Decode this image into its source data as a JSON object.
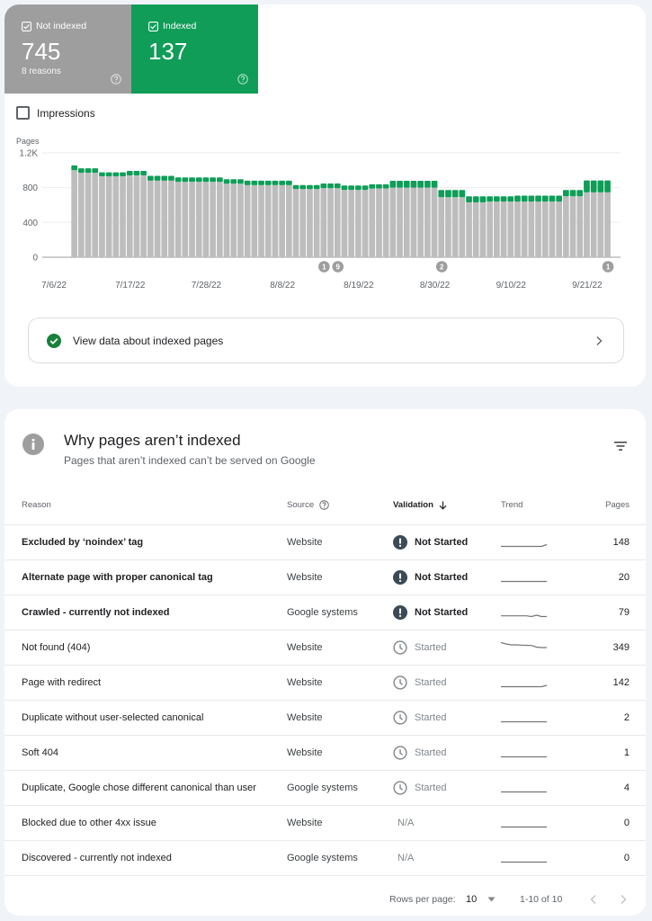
{
  "summary": {
    "not_indexed": {
      "label": "Not indexed",
      "value": "745",
      "sub": "8 reasons",
      "checked": true,
      "color": "#9e9e9e",
      "icon": "help-icon"
    },
    "indexed": {
      "label": "Indexed",
      "value": "137",
      "checked": true,
      "color": "#0f9d58",
      "icon": "help-icon"
    }
  },
  "impressions": {
    "label": "Impressions",
    "checked": false
  },
  "chart_data": {
    "type": "bar",
    "stacked": true,
    "ylabel": "Pages",
    "xlabel": "",
    "ylim": [
      0,
      1200
    ],
    "yticks": [
      0,
      400,
      800,
      1200
    ],
    "ytick_labels": [
      "0",
      "400",
      "800",
      "1.2K"
    ],
    "grid": true,
    "xticks": [
      "7/6/22",
      "7/17/22",
      "7/28/22",
      "8/8/22",
      "8/19/22",
      "8/30/22",
      "9/10/22",
      "9/21/22"
    ],
    "x": [
      "7/9/22",
      "7/10/22",
      "7/11/22",
      "7/12/22",
      "7/13/22",
      "7/14/22",
      "7/15/22",
      "7/16/22",
      "7/17/22",
      "7/18/22",
      "7/19/22",
      "7/20/22",
      "7/21/22",
      "7/22/22",
      "7/23/22",
      "7/24/22",
      "7/25/22",
      "7/26/22",
      "7/27/22",
      "7/28/22",
      "7/29/22",
      "7/30/22",
      "7/31/22",
      "8/1/22",
      "8/2/22",
      "8/3/22",
      "8/4/22",
      "8/5/22",
      "8/6/22",
      "8/7/22",
      "8/8/22",
      "8/9/22",
      "8/10/22",
      "8/11/22",
      "8/12/22",
      "8/13/22",
      "8/14/22",
      "8/15/22",
      "8/16/22",
      "8/17/22",
      "8/18/22",
      "8/19/22",
      "8/20/22",
      "8/21/22",
      "8/22/22",
      "8/23/22",
      "8/24/22",
      "8/25/22",
      "8/26/22",
      "8/27/22",
      "8/28/22",
      "8/29/22",
      "8/30/22",
      "8/31/22",
      "9/1/22",
      "9/2/22",
      "9/3/22",
      "9/4/22",
      "9/5/22",
      "9/6/22",
      "9/7/22",
      "9/8/22",
      "9/9/22",
      "9/10/22",
      "9/11/22",
      "9/12/22",
      "9/13/22",
      "9/14/22",
      "9/15/22",
      "9/16/22",
      "9/17/22",
      "9/18/22",
      "9/19/22",
      "9/20/22",
      "9/21/22",
      "9/22/22",
      "9/23/22",
      "9/24/22"
    ],
    "series": [
      {
        "name": "Not indexed",
        "color": "#bdbdbd",
        "values": [
          1000,
          970,
          970,
          970,
          930,
          930,
          930,
          930,
          940,
          940,
          940,
          880,
          880,
          880,
          880,
          865,
          865,
          865,
          865,
          865,
          865,
          865,
          845,
          845,
          845,
          828,
          828,
          828,
          828,
          828,
          828,
          828,
          783,
          783,
          783,
          783,
          793,
          793,
          793,
          772,
          772,
          772,
          772,
          789,
          789,
          789,
          800,
          800,
          800,
          800,
          800,
          800,
          800,
          690,
          690,
          690,
          690,
          630,
          630,
          630,
          640,
          640,
          640,
          640,
          640,
          640,
          640,
          640,
          640,
          640,
          640,
          700,
          700,
          700,
          745,
          745,
          745,
          745
        ]
      },
      {
        "name": "Indexed",
        "color": "#0f9d58",
        "values": [
          55,
          52,
          52,
          52,
          45,
          45,
          45,
          45,
          52,
          52,
          52,
          55,
          55,
          55,
          55,
          52,
          52,
          52,
          52,
          52,
          52,
          52,
          51,
          51,
          51,
          52,
          52,
          52,
          52,
          52,
          52,
          52,
          47,
          47,
          47,
          47,
          55,
          55,
          55,
          52,
          52,
          52,
          52,
          49,
          49,
          49,
          79,
          79,
          79,
          79,
          79,
          79,
          79,
          82,
          82,
          82,
          82,
          70,
          70,
          70,
          60,
          60,
          60,
          60,
          68,
          68,
          68,
          68,
          68,
          68,
          68,
          72,
          72,
          72,
          137,
          137,
          137,
          137
        ]
      }
    ],
    "annotations": [
      {
        "date": "8/14/22",
        "label": "1"
      },
      {
        "date": "8/16/22",
        "label": "9"
      },
      {
        "date": "8/31/22",
        "label": "2"
      },
      {
        "date": "9/24/22",
        "label": "1"
      }
    ]
  },
  "view_indexed": {
    "label": "View data about indexed pages",
    "icon": "check-circle-icon",
    "accent": "#188038"
  },
  "why": {
    "title": "Why pages aren’t indexed",
    "subtitle": "Pages that aren’t indexed can’t be served on Google"
  },
  "table": {
    "headers": {
      "reason": "Reason",
      "source": "Source",
      "validation": "Validation",
      "trend": "Trend",
      "pages": "Pages"
    },
    "sort": {
      "column": "validation",
      "direction": "descending"
    },
    "rows": [
      {
        "reason": "Excluded by ‘noindex’ tag",
        "source": "Website",
        "validation": "Not Started",
        "status_icon": "exclamation-icon",
        "bold": true,
        "trend": [
          0,
          0,
          0,
          0,
          0,
          0,
          0,
          0,
          0,
          0.2
        ],
        "pages": "148"
      },
      {
        "reason": "Alternate page with proper canonical tag",
        "source": "Website",
        "validation": "Not Started",
        "status_icon": "exclamation-icon",
        "bold": true,
        "trend": [
          0,
          0,
          0,
          0,
          0,
          0,
          0,
          0,
          0,
          0
        ],
        "pages": "20"
      },
      {
        "reason": "Crawled - currently not indexed",
        "source": "Google systems",
        "validation": "Not Started",
        "status_icon": "exclamation-icon",
        "bold": true,
        "trend": [
          0.08,
          0.08,
          0.08,
          0.08,
          0.08,
          0.08,
          0.0,
          0.15,
          0.0,
          0.0
        ],
        "pages": "79"
      },
      {
        "reason": "Not found (404)",
        "source": "Website",
        "validation": "Started",
        "status_icon": "clock-icon",
        "bold": false,
        "trend": [
          1.0,
          0.85,
          0.75,
          0.75,
          0.72,
          0.7,
          0.68,
          0.5,
          0.45,
          0.45
        ],
        "pages": "349"
      },
      {
        "reason": "Page with redirect",
        "source": "Website",
        "validation": "Started",
        "status_icon": "clock-icon",
        "bold": false,
        "trend": [
          0,
          0,
          0,
          0,
          0,
          0,
          0,
          0,
          0,
          0.15
        ],
        "pages": "142"
      },
      {
        "reason": "Duplicate without user-selected canonical",
        "source": "Website",
        "validation": "Started",
        "status_icon": "clock-icon",
        "bold": false,
        "trend": [
          0,
          0,
          0,
          0,
          0,
          0,
          0,
          0,
          0,
          0
        ],
        "pages": "2"
      },
      {
        "reason": "Soft 404",
        "source": "Website",
        "validation": "Started",
        "status_icon": "clock-icon",
        "bold": false,
        "trend": [
          0,
          0,
          0,
          0,
          0,
          0,
          0,
          0,
          0,
          0
        ],
        "pages": "1"
      },
      {
        "reason": "Duplicate, Google chose different canonical than user",
        "source": "Google systems",
        "validation": "Started",
        "status_icon": "clock-icon",
        "bold": false,
        "trend": [
          0,
          0,
          0,
          0,
          0,
          0,
          0,
          0,
          0,
          0
        ],
        "pages": "4"
      },
      {
        "reason": "Blocked due to other 4xx issue",
        "source": "Website",
        "validation": "N/A",
        "status_icon": null,
        "bold": false,
        "trend": [
          0,
          0,
          0,
          0,
          0,
          0,
          0,
          0,
          0,
          0
        ],
        "pages": "0"
      },
      {
        "reason": "Discovered - currently not indexed",
        "source": "Google systems",
        "validation": "N/A",
        "status_icon": null,
        "bold": false,
        "trend": [
          0,
          0,
          0,
          0,
          0,
          0,
          0,
          0,
          0,
          0
        ],
        "pages": "0"
      }
    ]
  },
  "pagination": {
    "rows_per_page_label": "Rows per page:",
    "rows_per_page": "10",
    "range": "1-10 of 10"
  }
}
